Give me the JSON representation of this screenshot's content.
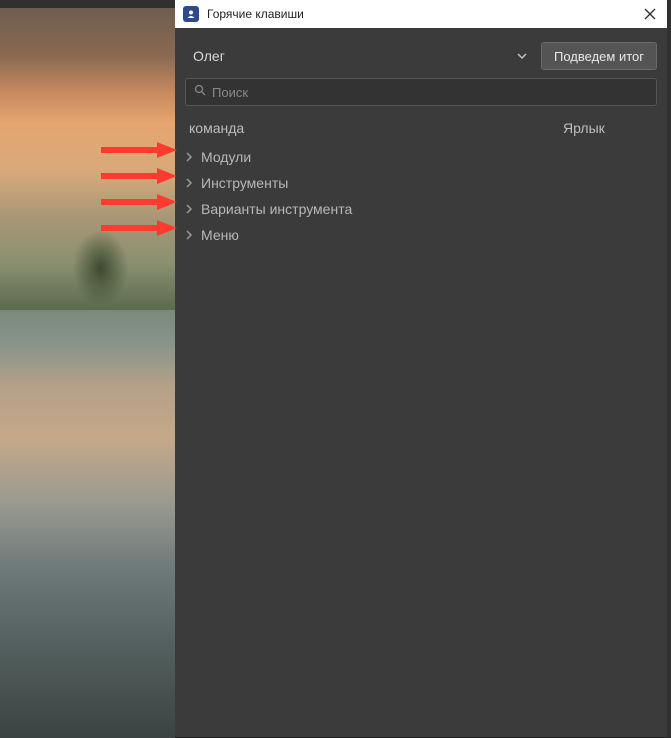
{
  "dialog": {
    "title": "Горячие клавиши"
  },
  "toolbar": {
    "dropdown_label": "Олег",
    "summary_button": "Подведем итог"
  },
  "search": {
    "placeholder": "Поиск"
  },
  "headers": {
    "command": "команда",
    "shortcut": "Ярлык"
  },
  "tree": {
    "items": [
      {
        "label": "Модули"
      },
      {
        "label": "Инструменты"
      },
      {
        "label": "Варианты инструмента"
      },
      {
        "label": "Меню"
      }
    ]
  },
  "arrows": {
    "color": "#ff3b30",
    "positions": [
      140,
      166,
      192,
      218
    ]
  }
}
